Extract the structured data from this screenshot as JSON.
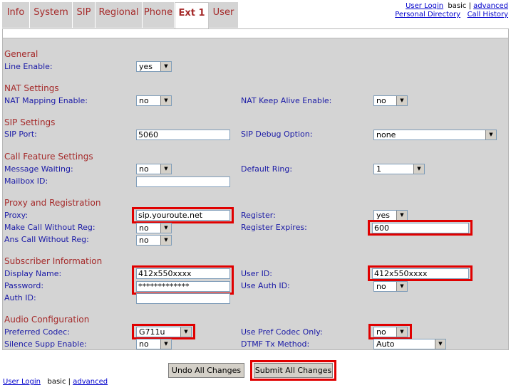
{
  "tabs": [
    {
      "label": "Info"
    },
    {
      "label": "System"
    },
    {
      "label": "SIP"
    },
    {
      "label": "Regional"
    },
    {
      "label": "Phone"
    },
    {
      "label": "Ext 1"
    },
    {
      "label": "User"
    }
  ],
  "active_tab": "Ext 1",
  "top_links": {
    "user_login": "User Login",
    "basic": "basic",
    "separator": "|",
    "advanced": "advanced",
    "personal_directory": "Personal Directory",
    "call_history": "Call History"
  },
  "sections": {
    "general": "General",
    "nat": "NAT Settings",
    "sip": "SIP Settings",
    "call_feature": "Call Feature Settings",
    "proxy": "Proxy and Registration",
    "subscriber": "Subscriber Information",
    "audio": "Audio Configuration"
  },
  "fields": {
    "line_enable": {
      "label": "Line Enable:",
      "value": "yes"
    },
    "nat_mapping": {
      "label": "NAT Mapping Enable:",
      "value": "no"
    },
    "nat_keepalive": {
      "label": "NAT Keep Alive Enable:",
      "value": "no"
    },
    "sip_port": {
      "label": "SIP Port:",
      "value": "5060"
    },
    "sip_debug": {
      "label": "SIP Debug Option:",
      "value": "none"
    },
    "message_waiting": {
      "label": "Message Waiting:",
      "value": "no"
    },
    "default_ring": {
      "label": "Default Ring:",
      "value": "1"
    },
    "mailbox_id": {
      "label": "Mailbox ID:",
      "value": ""
    },
    "proxy": {
      "label": "Proxy:",
      "value": "sip.youroute.net"
    },
    "register": {
      "label": "Register:",
      "value": "yes"
    },
    "make_call_without_reg": {
      "label": "Make Call Without Reg:",
      "value": "no"
    },
    "register_expires": {
      "label": "Register Expires:",
      "value": "600"
    },
    "ans_call_without_reg": {
      "label": "Ans Call Without Reg:",
      "value": "no"
    },
    "display_name": {
      "label": "Display Name:",
      "value": "412x550xxxx"
    },
    "user_id": {
      "label": "User ID:",
      "value": "412x550xxxx"
    },
    "password": {
      "label": "Password:",
      "value": "*************"
    },
    "use_auth_id": {
      "label": "Use Auth ID:",
      "value": "no"
    },
    "auth_id": {
      "label": "Auth ID:",
      "value": ""
    },
    "preferred_codec": {
      "label": "Preferred Codec:",
      "value": "G711u"
    },
    "use_pref_codec_only": {
      "label": "Use Pref Codec Only:",
      "value": "no"
    },
    "silence_supp": {
      "label": "Silence Supp Enable:",
      "value": "no"
    },
    "dtmf_tx_method": {
      "label": "DTMF Tx Method:",
      "value": "Auto"
    }
  },
  "buttons": {
    "undo": "Undo All Changes",
    "submit": "Submit All Changes"
  },
  "bottom_links": {
    "user_login": "User Login",
    "basic": "basic",
    "separator": "|",
    "advanced": "advanced"
  },
  "colors": {
    "accent": "#a52a2a",
    "label": "#1a1aa6",
    "panel": "#d4d4d4",
    "highlight": "#e00000"
  }
}
